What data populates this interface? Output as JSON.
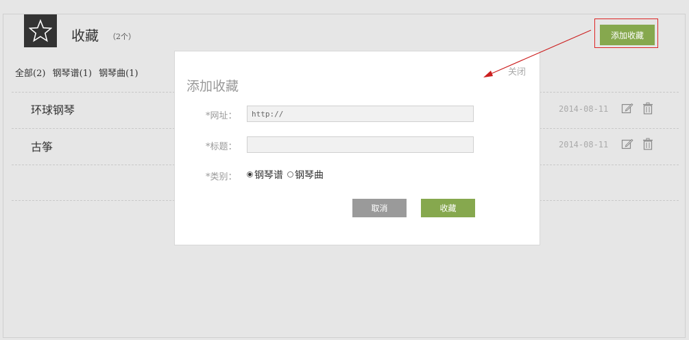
{
  "header": {
    "icon": "star-icon",
    "title": "收藏",
    "count": "（2个）",
    "add_button": "添加收藏"
  },
  "filters": [
    {
      "label": "全部(2)"
    },
    {
      "label": "钢琴谱(1)"
    },
    {
      "label": "钢琴曲(1)"
    }
  ],
  "list": [
    {
      "title": "环球钢琴",
      "date": "2014-08-11"
    },
    {
      "title": "古筝",
      "date": "2014-08-11"
    }
  ],
  "modal": {
    "title": "添加收藏",
    "close": "关闭",
    "url_label": "*网址：",
    "url_value": "http://",
    "title_label": "*标题：",
    "title_value": "",
    "category_label": "*类别：",
    "category_options": [
      "钢琴谱",
      "钢琴曲"
    ],
    "category_selected": "钢琴谱",
    "cancel_button": "取消",
    "save_button": "收藏"
  },
  "colors": {
    "accent_green": "#86a84e",
    "highlight_red": "#d22222"
  }
}
